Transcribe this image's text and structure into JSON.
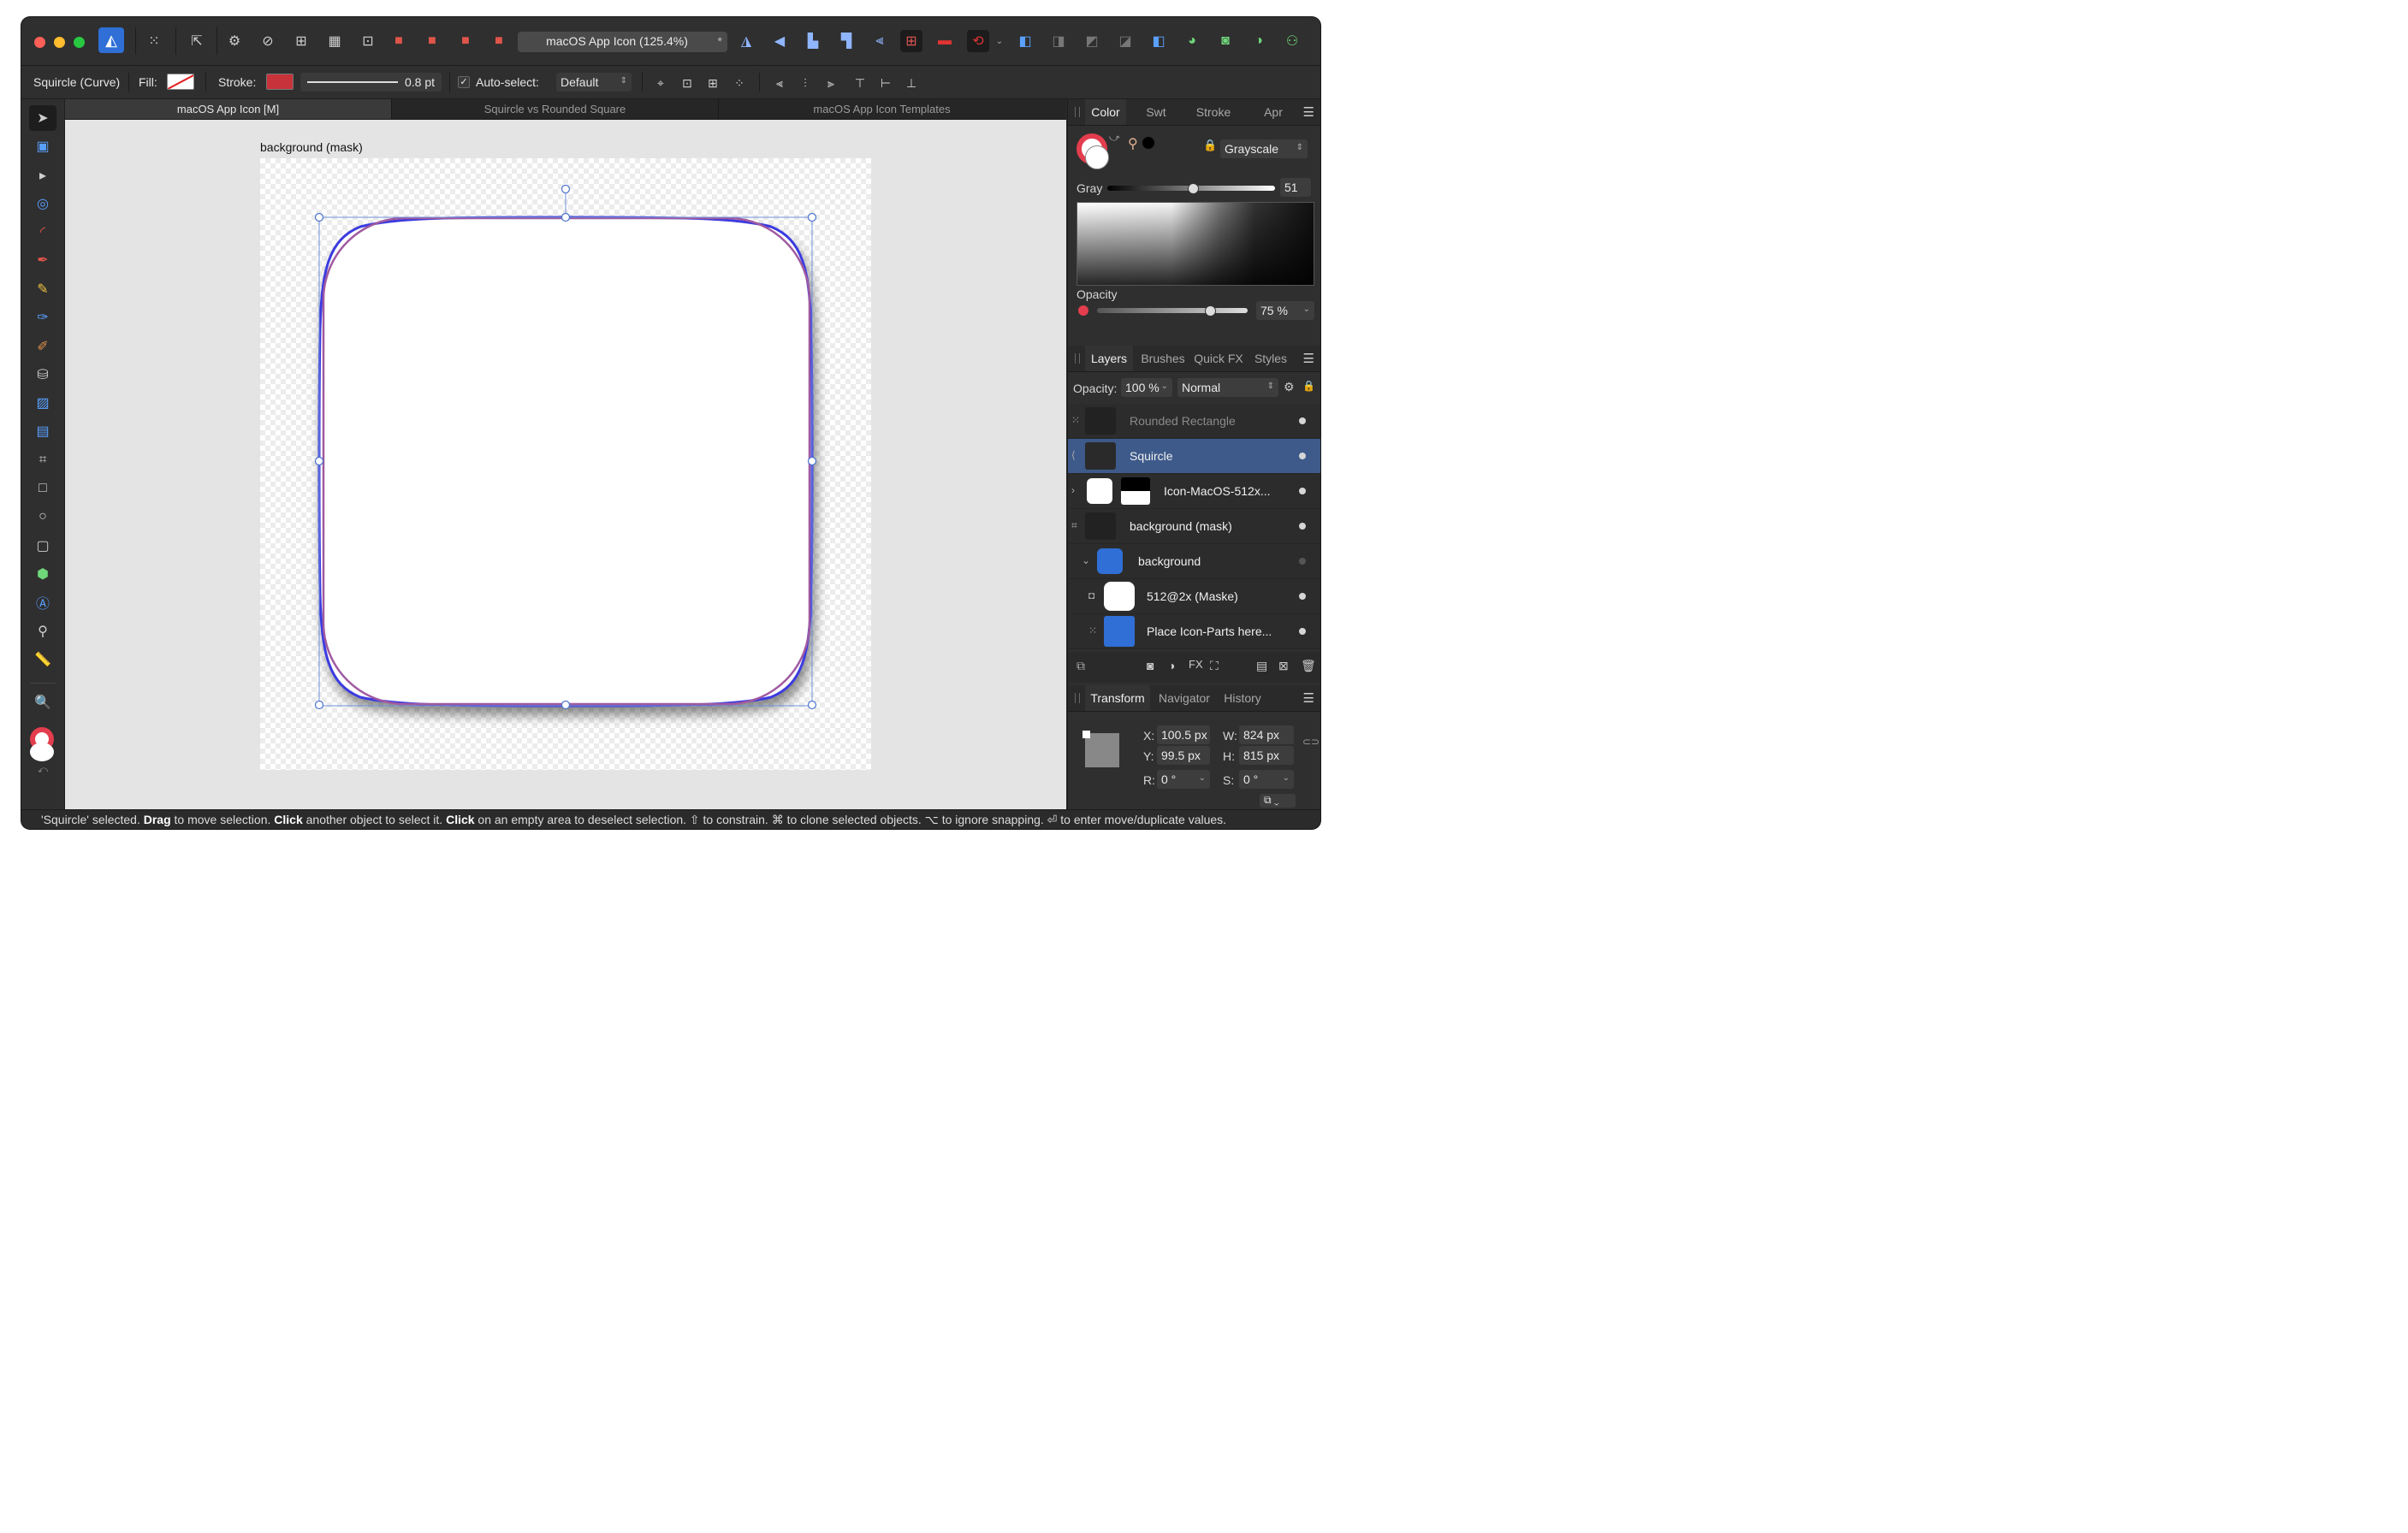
{
  "window": {
    "doc_title": "macOS App Icon (125.4%)",
    "modified_marker": "*"
  },
  "context_bar": {
    "selection_type": "Squircle (Curve)",
    "fill_label": "Fill:",
    "stroke_label": "Stroke:",
    "stroke_width": "0.8 pt",
    "auto_select_label": "Auto-select:",
    "auto_select_value": "Default"
  },
  "doc_tabs": [
    {
      "label": "macOS App Icon [M]",
      "active": true
    },
    {
      "label": "Squircle vs Rounded Square",
      "active": false
    },
    {
      "label": "macOS App Icon Templates",
      "active": false
    }
  ],
  "canvas": {
    "artboard_label": "background (mask)"
  },
  "color_panel": {
    "tabs": [
      "Color",
      "Swt",
      "Stroke",
      "Apr"
    ],
    "active_tab": "Color",
    "mode": "Grayscale",
    "gray_label": "Gray",
    "gray_value": "51",
    "gray_fraction": 0.51,
    "opacity_label": "Opacity",
    "opacity_value": "75 %",
    "opacity_fraction": 0.75
  },
  "layers_panel": {
    "tabs": [
      "Layers",
      "Brushes",
      "Quick FX",
      "Styles"
    ],
    "active_tab": "Layers",
    "opacity_label": "Opacity:",
    "opacity_value": "100 %",
    "blend_mode": "Normal",
    "layers": [
      {
        "name": "Rounded Rectangle",
        "dim": true,
        "selected": false
      },
      {
        "name": "Squircle",
        "dim": false,
        "selected": true
      },
      {
        "name": "Icon-MacOS-512x...",
        "dim": false,
        "selected": false
      },
      {
        "name": "background (mask)",
        "dim": false,
        "selected": false
      },
      {
        "name": "background",
        "dim": false,
        "selected": false
      },
      {
        "name": "512@2x (Maske)",
        "dim": false,
        "selected": false
      },
      {
        "name": "Place Icon-Parts here...",
        "dim": false,
        "selected": false
      }
    ]
  },
  "transform_panel": {
    "tabs": [
      "Transform",
      "Navigator",
      "History"
    ],
    "active_tab": "Transform",
    "x_label": "X:",
    "x_value": "100.5 px",
    "y_label": "Y:",
    "y_value": "99.5 px",
    "w_label": "W:",
    "w_value": "824 px",
    "h_label": "H:",
    "h_value": "815 px",
    "r_label": "R:",
    "r_value": "0 °",
    "s_label": "S:",
    "s_value": "0 °"
  },
  "status": {
    "p1": "'Squircle' selected. ",
    "b1": "Drag",
    "p2": " to move selection. ",
    "b2": "Click",
    "p3": " another object to select it. ",
    "b3": "Click",
    "p4": " on an empty area to deselect selection. ⇧ to constrain. ⌘ to clone selected objects. ⌥ to ignore snapping. ⏎ to enter move/duplicate values."
  },
  "colors": {
    "selection_blue": "#3a3ae0",
    "rounded_rect_stroke": "#a05aa0",
    "layer_selected": "#3d5a8a",
    "stroke_red": "#c8323a",
    "app_accent": "#2f6fd6"
  }
}
